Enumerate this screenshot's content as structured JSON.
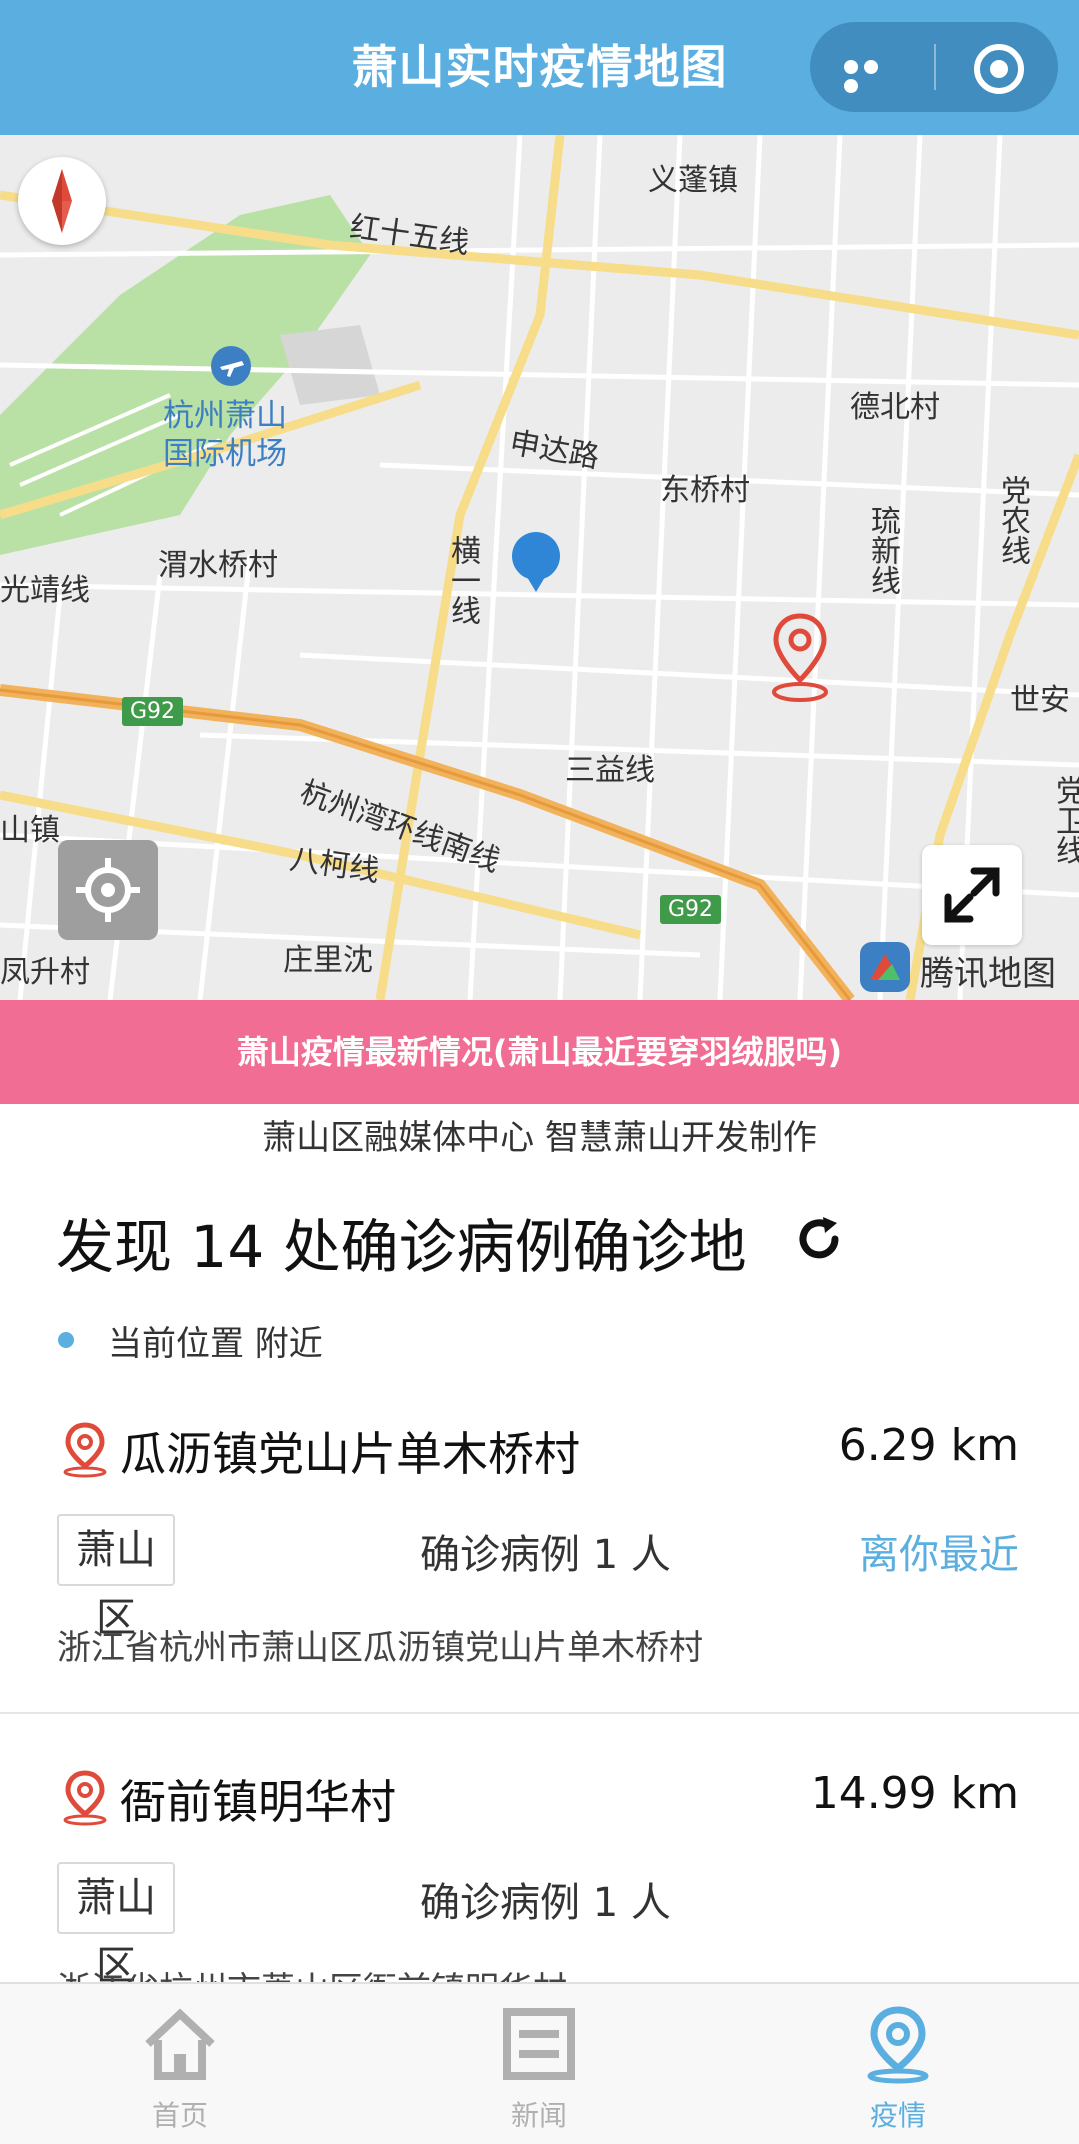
{
  "header": {
    "title": "萧山实时疫情地图"
  },
  "map": {
    "labels": {
      "yipeng": "义蓬镇",
      "hongshiwu": "红十五线",
      "airport": "杭州萧山\n国际机场",
      "debei": "德北村",
      "shenda": "申达路",
      "dongqiao": "东桥村",
      "dangnong": "党农线",
      "liuxin": "琉新线",
      "heng": "横一线",
      "weishui": "渭水桥村",
      "guangjing": "光靖线",
      "shian": "世安",
      "g92a": "G92",
      "g92b": "G92",
      "hangzhouwan": "杭州湾环线南线",
      "sanyi": "三益线",
      "shanzhen": "山镇",
      "bake": "八柯线",
      "dangwei": "党卫线",
      "zhuangli": "庄里沈",
      "fengsheng": "凤升村"
    },
    "brand": "腾讯地图"
  },
  "banner": {
    "text": "萧山疫情最新情况(萧山最近要穿羽绒服吗)"
  },
  "subtitle": "萧山区融媒体中心 智慧萧山开发制作",
  "found": {
    "title": "发现 14 处确诊病例确诊地"
  },
  "location": {
    "text": "当前位置 附近"
  },
  "cases": [
    {
      "name": "瓜沥镇党山片单木桥村",
      "distance": "6.29 km",
      "district": "萧山区",
      "count": "确诊病例 1 人",
      "tag": "离你最近",
      "address": "浙江省杭州市萧山区瓜沥镇党山片单木桥村"
    },
    {
      "name": "衙前镇明华村",
      "distance": "14.99 km",
      "district": "萧山区",
      "count": "确诊病例 1 人",
      "address": "浙江省杭州市萧山区衙前镇明华村"
    }
  ],
  "tabbar": {
    "items": [
      {
        "label": "首页",
        "icon": "home-icon"
      },
      {
        "label": "新闻",
        "icon": "news-icon"
      },
      {
        "label": "疫情",
        "icon": "epidemic-pin-icon"
      }
    ],
    "active": "疫情"
  },
  "colors": {
    "header": "#5aaee0",
    "banner": "#f26d94",
    "accent": "#5aaee0",
    "pin": "#e04a3a"
  }
}
